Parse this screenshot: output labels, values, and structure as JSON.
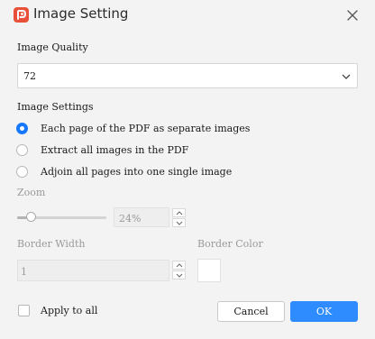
{
  "dialog": {
    "title": "Image Setting",
    "app_icon": "pdf-app-logo",
    "close_icon": "close-icon"
  },
  "quality": {
    "label": "Image Quality",
    "value": "72",
    "chevron_icon": "chevron-down-icon"
  },
  "settings": {
    "label": "Image Settings",
    "options": [
      {
        "label": "Each page of the PDF as separate images",
        "checked": true
      },
      {
        "label": "Extract all images in the PDF",
        "checked": false
      },
      {
        "label": "Adjoin all pages into one single image",
        "checked": false
      }
    ]
  },
  "zoom": {
    "label": "Zoom",
    "value_text": "24%",
    "level": 0.16
  },
  "border_width": {
    "label": "Border Width",
    "value": "1"
  },
  "border_color": {
    "label": "Border Color",
    "color": "#ffffff"
  },
  "apply_all": {
    "label": "Apply to all",
    "checked": false
  },
  "buttons": {
    "cancel": "Cancel",
    "ok": "OK"
  },
  "colors": {
    "accent": "#1677ff",
    "ok_button": "#2e8cff",
    "logo": "#e8503a"
  }
}
